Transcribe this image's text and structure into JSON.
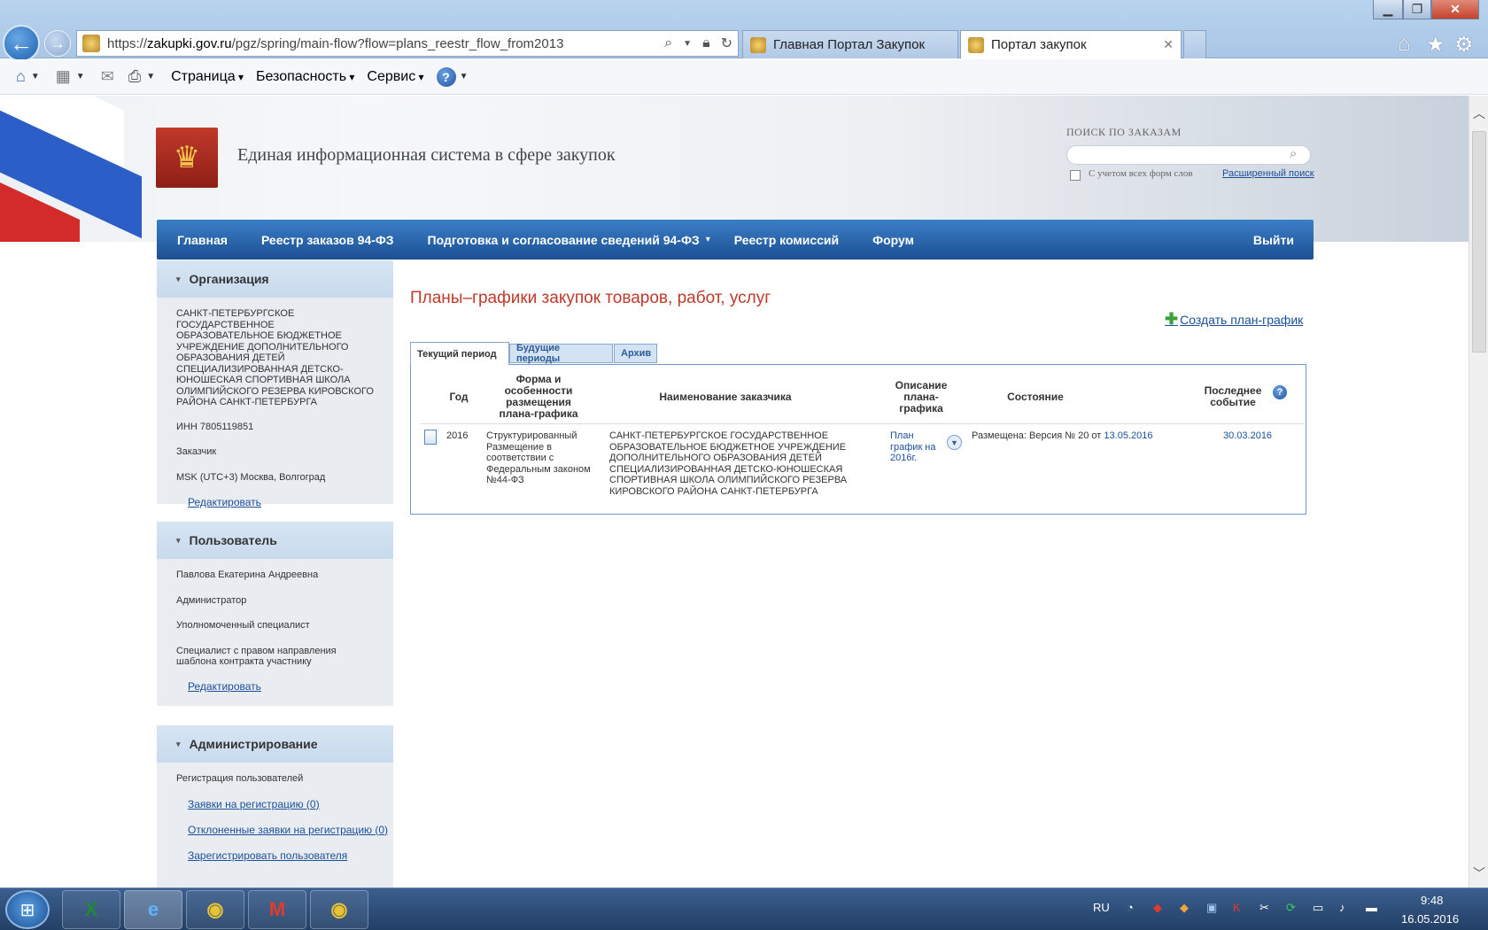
{
  "browser": {
    "address": {
      "scheme": "https://",
      "host": "zakupki.gov.ru",
      "path": "/pgz/spring/main-flow?flow=plans_reestr_flow_from2013"
    },
    "tabs": [
      {
        "label": "Главная Портал Закупок"
      },
      {
        "label": "Портал закупок"
      }
    ],
    "command_menus": [
      "Страница",
      "Безопасность",
      "Сервис"
    ]
  },
  "header": {
    "site_title": "Единая информационная система в сфере закупок",
    "search_label": "ПОИСК ПО ЗАКАЗАМ",
    "search_value": "",
    "search_option": "С учетом всех форм слов",
    "advanced_search": "Расширенный поиск"
  },
  "nav": {
    "items": [
      "Главная",
      "Реестр заказов 94-ФЗ",
      "Подготовка и согласование сведений 94-ФЗ",
      "Реестр комиссий",
      "Форум"
    ],
    "logout": "Выйти"
  },
  "sidebar": {
    "organization": {
      "title": "Организация",
      "name": "САНКТ-ПЕТЕРБУРГСКОЕ ГОСУДАРСТВЕННОЕ ОБРАЗОВАТЕЛЬНОЕ БЮДЖЕТНОЕ УЧРЕЖДЕНИЕ ДОПОЛНИТЕЛЬНОГО ОБРАЗОВАНИЯ ДЕТЕЙ СПЕЦИАЛИЗИРОВАННАЯ ДЕТСКО-ЮНОШЕСКАЯ СПОРТИВНАЯ ШКОЛА ОЛИМПИЙСКОГО РЕЗЕРВА КИРОВСКОГО РАЙОНА САНКТ-ПЕТЕРБУРГА",
      "inn": "ИНН 7805119851",
      "role": "Заказчик",
      "timezone": "MSK (UTC+3) Москва, Волгоград",
      "edit": "Редактировать"
    },
    "user": {
      "title": "Пользователь",
      "name": "Павлова Екатерина Андреевна",
      "roles": [
        "Администратор",
        "Уполномоченный специалист",
        "Специалист с правом направления шаблона контракта участнику"
      ],
      "edit": "Редактировать"
    },
    "admin": {
      "title": "Администрирование",
      "section": "Регистрация пользователей",
      "links": [
        "Заявки на регистрацию (0)",
        "Отклоненные заявки на регистрацию (0)",
        "Зарегистрировать пользователя"
      ]
    }
  },
  "main": {
    "title": "Планы–графики закупок товаров, работ, услуг",
    "create_link": "Создать план-график",
    "tabs": [
      "Текущий период",
      "Будущие периоды",
      "Архив"
    ],
    "columns": [
      "Год",
      "Форма и особенности размещения плана-графика",
      "Наименование заказчика",
      "Описание плана-графика",
      "Состояние",
      "Последнее событие"
    ],
    "rows": [
      {
        "year": "2016",
        "form": "Структурированный Размещение в соответствии с Федеральным законом №44-ФЗ",
        "customer": "САНКТ-ПЕТЕРБУРГСКОЕ ГОСУДАРСТВЕННОЕ ОБРАЗОВАТЕЛЬНОЕ БЮДЖЕТНОЕ УЧРЕЖДЕНИЕ ДОПОЛНИТЕЛЬНОГО ОБРАЗОВАНИЯ ДЕТЕЙ СПЕЦИАЛИЗИРОВАННАЯ ДЕТСКО-ЮНОШЕСКАЯ СПОРТИВНАЯ ШКОЛА ОЛИМПИЙСКОГО РЕЗЕРВА КИРОВСКОГО РАЙОНА САНКТ-ПЕТЕРБУРГА",
        "description": "План график на 2016г.",
        "status_prefix": "Размещена: Версия №  20 от",
        "status_date": "13.05.2016",
        "last_event": "30.03.2016"
      }
    ]
  },
  "taskbar": {
    "lang": "RU",
    "time": "9:48",
    "date": "16.05.2016"
  }
}
